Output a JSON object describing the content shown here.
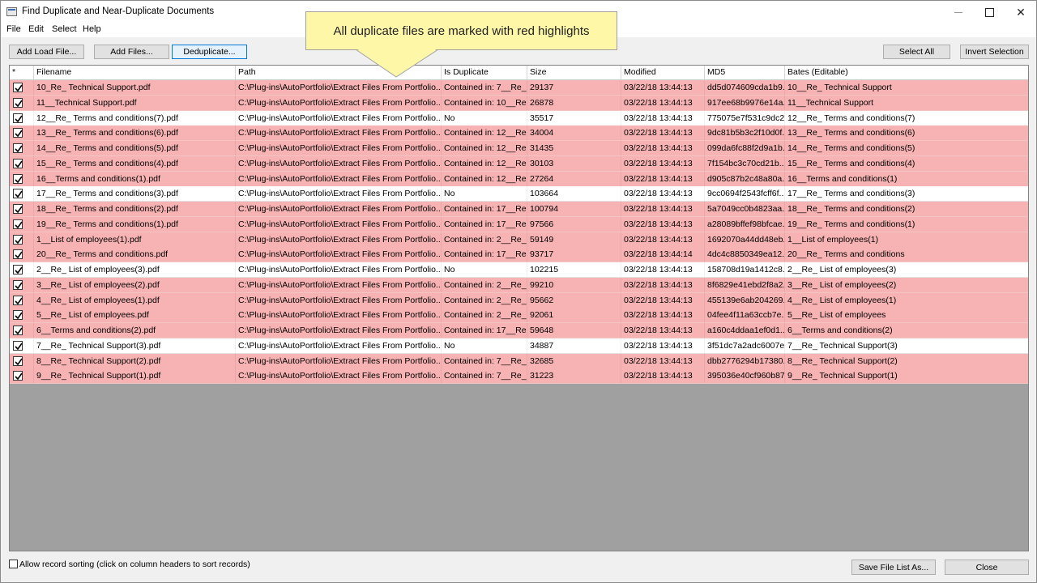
{
  "window": {
    "title": "Find Duplicate and Near-Duplicate Documents"
  },
  "menu": [
    "File",
    "Edit",
    "Select",
    "Help"
  ],
  "toolbar": {
    "add_load_file": "Add Load File...",
    "add_files": "Add Files...",
    "deduplicate": "Deduplicate...",
    "select_all": "Select All",
    "invert_selection": "Invert Selection"
  },
  "callout": {
    "text": "All duplicate files are marked with red highlights"
  },
  "grid": {
    "columns": [
      "*",
      "Filename",
      "Path",
      "Is Duplicate",
      "Size",
      "Modified",
      "MD5",
      "Bates (Editable)"
    ],
    "rows": [
      {
        "dup": true,
        "filename": "10_Re_ Technical Support.pdf",
        "path": "C:\\Plug-ins\\AutoPortfolio\\Extract Files From Portfolio...",
        "is_duplicate": "Contained in: 7__Re_ ...",
        "size": "29137",
        "modified": "03/22/18 13:44:13",
        "md5": "dd5d074609cda1b9...",
        "bates": "10__Re_ Technical Support"
      },
      {
        "dup": true,
        "filename": "11__Technical Support.pdf",
        "path": "C:\\Plug-ins\\AutoPortfolio\\Extract Files From Portfolio...",
        "is_duplicate": "Contained in: 10__Re...",
        "size": "26878",
        "modified": "03/22/18 13:44:13",
        "md5": "917ee68b9976e14a...",
        "bates": "11__Technical Support"
      },
      {
        "dup": false,
        "filename": "12__Re_ Terms and conditions(7).pdf",
        "path": "C:\\Plug-ins\\AutoPortfolio\\Extract Files From Portfolio...",
        "is_duplicate": "No",
        "size": "35517",
        "modified": "03/22/18 13:44:13",
        "md5": "775075e7f531c9dc2...",
        "bates": "12__Re_ Terms and conditions(7)"
      },
      {
        "dup": true,
        "filename": "13__Re_ Terms and conditions(6).pdf",
        "path": "C:\\Plug-ins\\AutoPortfolio\\Extract Files From Portfolio...",
        "is_duplicate": "Contained in: 12__Re...",
        "size": "34004",
        "modified": "03/22/18 13:44:13",
        "md5": "9dc81b5b3c2f10d0f...",
        "bates": "13__Re_ Terms and conditions(6)"
      },
      {
        "dup": true,
        "filename": "14__Re_ Terms and conditions(5).pdf",
        "path": "C:\\Plug-ins\\AutoPortfolio\\Extract Files From Portfolio...",
        "is_duplicate": "Contained in: 12__Re...",
        "size": "31435",
        "modified": "03/22/18 13:44:13",
        "md5": "099da6fc88f2d9a1b...",
        "bates": "14__Re_ Terms and conditions(5)"
      },
      {
        "dup": true,
        "filename": "15__Re_ Terms and conditions(4).pdf",
        "path": "C:\\Plug-ins\\AutoPortfolio\\Extract Files From Portfolio...",
        "is_duplicate": "Contained in: 12__Re...",
        "size": "30103",
        "modified": "03/22/18 13:44:13",
        "md5": "7f154bc3c70cd21b...",
        "bates": "15__Re_ Terms and conditions(4)"
      },
      {
        "dup": true,
        "filename": "16__Terms and conditions(1).pdf",
        "path": "C:\\Plug-ins\\AutoPortfolio\\Extract Files From Portfolio...",
        "is_duplicate": "Contained in: 12__Re...",
        "size": "27264",
        "modified": "03/22/18 13:44:13",
        "md5": "d905c87b2c48a80a...",
        "bates": "16__Terms and conditions(1)"
      },
      {
        "dup": false,
        "filename": "17__Re_ Terms and conditions(3).pdf",
        "path": "C:\\Plug-ins\\AutoPortfolio\\Extract Files From Portfolio...",
        "is_duplicate": "No",
        "size": "103664",
        "modified": "03/22/18 13:44:13",
        "md5": "9cc0694f2543fcff6f...",
        "bates": "17__Re_ Terms and conditions(3)"
      },
      {
        "dup": true,
        "filename": "18__Re_ Terms and conditions(2).pdf",
        "path": "C:\\Plug-ins\\AutoPortfolio\\Extract Files From Portfolio...",
        "is_duplicate": "Contained in: 17__Re...",
        "size": "100794",
        "modified": "03/22/18 13:44:13",
        "md5": "5a7049cc0b4823aa...",
        "bates": "18__Re_ Terms and conditions(2)"
      },
      {
        "dup": true,
        "filename": "19__Re_ Terms and conditions(1).pdf",
        "path": "C:\\Plug-ins\\AutoPortfolio\\Extract Files From Portfolio...",
        "is_duplicate": "Contained in: 17__Re...",
        "size": "97566",
        "modified": "03/22/18 13:44:13",
        "md5": "a28089bffef98bfcae...",
        "bates": "19__Re_ Terms and conditions(1)"
      },
      {
        "dup": true,
        "filename": "1__List of employees(1).pdf",
        "path": "C:\\Plug-ins\\AutoPortfolio\\Extract Files From Portfolio...",
        "is_duplicate": "Contained in: 2__Re_ ...",
        "size": "59149",
        "modified": "03/22/18 13:44:13",
        "md5": "1692070a44dd48eb...",
        "bates": "1__List of employees(1)"
      },
      {
        "dup": true,
        "filename": "20__Re_ Terms and conditions.pdf",
        "path": "C:\\Plug-ins\\AutoPortfolio\\Extract Files From Portfolio...",
        "is_duplicate": "Contained in: 17__Re...",
        "size": "93717",
        "modified": "03/22/18 13:44:14",
        "md5": "4dc4c8850349ea12...",
        "bates": "20__Re_ Terms and conditions"
      },
      {
        "dup": false,
        "filename": "2__Re_ List of employees(3).pdf",
        "path": "C:\\Plug-ins\\AutoPortfolio\\Extract Files From Portfolio...",
        "is_duplicate": "No",
        "size": "102215",
        "modified": "03/22/18 13:44:13",
        "md5": "158708d19a1412c8...",
        "bates": "2__Re_ List of employees(3)"
      },
      {
        "dup": true,
        "filename": "3__Re_ List of employees(2).pdf",
        "path": "C:\\Plug-ins\\AutoPortfolio\\Extract Files From Portfolio...",
        "is_duplicate": "Contained in: 2__Re_ ...",
        "size": "99210",
        "modified": "03/22/18 13:44:13",
        "md5": "8f6829e41ebd2f8a2...",
        "bates": "3__Re_ List of employees(2)"
      },
      {
        "dup": true,
        "filename": "4__Re_ List of employees(1).pdf",
        "path": "C:\\Plug-ins\\AutoPortfolio\\Extract Files From Portfolio...",
        "is_duplicate": "Contained in: 2__Re_ ...",
        "size": "95662",
        "modified": "03/22/18 13:44:13",
        "md5": "455139e6ab204269...",
        "bates": "4__Re_ List of employees(1)"
      },
      {
        "dup": true,
        "filename": "5__Re_ List of employees.pdf",
        "path": "C:\\Plug-ins\\AutoPortfolio\\Extract Files From Portfolio...",
        "is_duplicate": "Contained in: 2__Re_ ...",
        "size": "92061",
        "modified": "03/22/18 13:44:13",
        "md5": "04fee4f11a63ccb7e...",
        "bates": "5__Re_ List of employees"
      },
      {
        "dup": true,
        "filename": "6__Terms and conditions(2).pdf",
        "path": "C:\\Plug-ins\\AutoPortfolio\\Extract Files From Portfolio...",
        "is_duplicate": "Contained in: 17__Re...",
        "size": "59648",
        "modified": "03/22/18 13:44:13",
        "md5": "a160c4ddaa1ef0d1...",
        "bates": "6__Terms and conditions(2)"
      },
      {
        "dup": false,
        "filename": "7__Re_ Technical Support(3).pdf",
        "path": "C:\\Plug-ins\\AutoPortfolio\\Extract Files From Portfolio...",
        "is_duplicate": "No",
        "size": "34887",
        "modified": "03/22/18 13:44:13",
        "md5": "3f51dc7a2adc6007e...",
        "bates": "7__Re_ Technical Support(3)"
      },
      {
        "dup": true,
        "filename": "8__Re_ Technical Support(2).pdf",
        "path": "C:\\Plug-ins\\AutoPortfolio\\Extract Files From Portfolio...",
        "is_duplicate": "Contained in: 7__Re_ ...",
        "size": "32685",
        "modified": "03/22/18 13:44:13",
        "md5": "dbb2776294b17380...",
        "bates": "8__Re_ Technical Support(2)"
      },
      {
        "dup": true,
        "filename": "9__Re_ Technical Support(1).pdf",
        "path": "C:\\Plug-ins\\AutoPortfolio\\Extract Files From Portfolio...",
        "is_duplicate": "Contained in: 7__Re_ ...",
        "size": "31223",
        "modified": "03/22/18 13:44:13",
        "md5": "395036e40cf960b87...",
        "bates": "9__Re_ Technical Support(1)"
      }
    ]
  },
  "footer": {
    "allow_sorting": "Allow record sorting (click on column headers to sort records)",
    "save_file_list": "Save File List As...",
    "close": "Close"
  },
  "colors": {
    "duplicate_row": "#f7b3b3",
    "callout_bg": "#fff7a8",
    "grid_empty": "#a0a0a0"
  }
}
